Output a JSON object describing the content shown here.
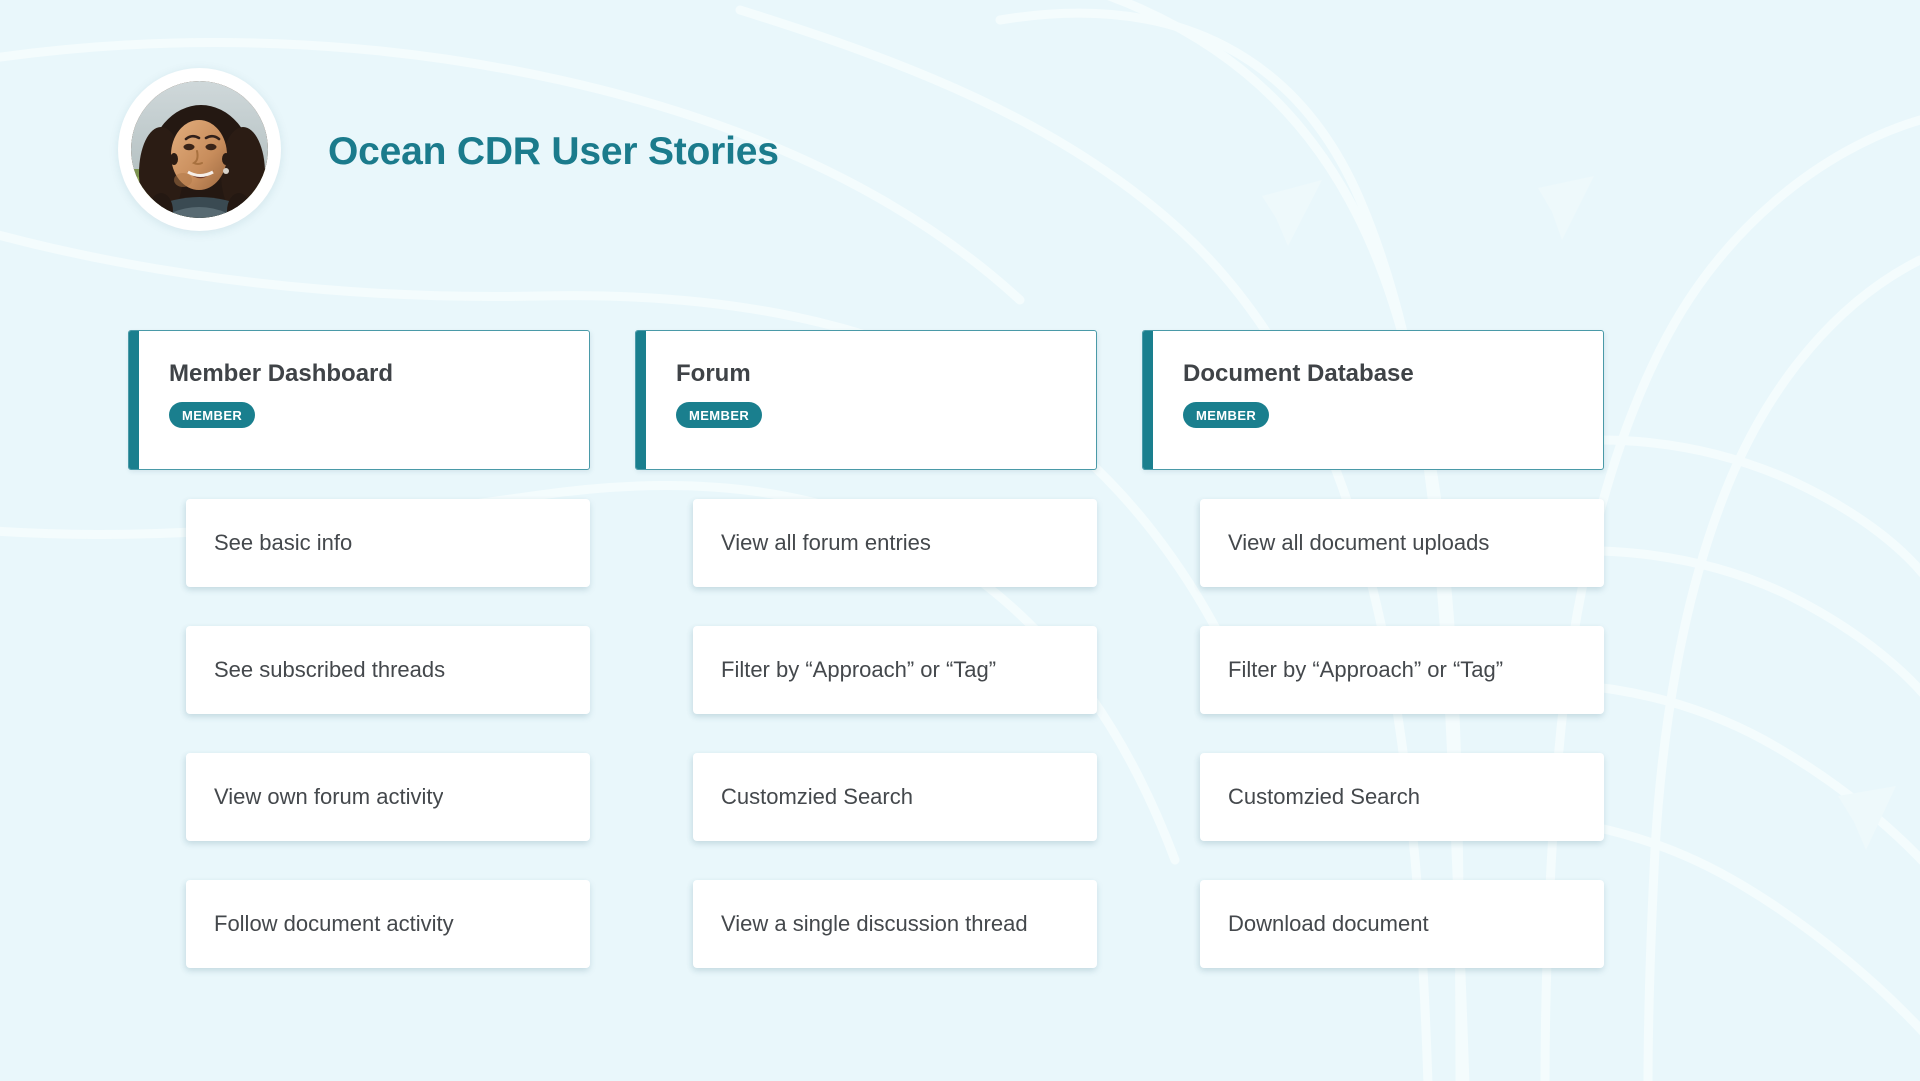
{
  "header": {
    "title": "Ocean CDR User Stories",
    "avatar_alt": "user-avatar-portrait"
  },
  "theme": {
    "background": "#e9f7fb",
    "accent_teal": "#1a7f8e",
    "title_color": "#1b7b8c",
    "card_background": "#ffffff",
    "text_color": "#44484c",
    "badge_text_color": "#ffffff"
  },
  "columns": [
    {
      "title": "Member Dashboard",
      "badge": "MEMBER",
      "items": [
        {
          "label": "See basic info"
        },
        {
          "label": "See subscribed threads"
        },
        {
          "label": "View own forum activity"
        },
        {
          "label": "Follow document activity"
        }
      ]
    },
    {
      "title": "Forum",
      "badge": "MEMBER",
      "items": [
        {
          "label": "View all forum entries"
        },
        {
          "label": "Filter by “Approach” or “Tag”"
        },
        {
          "label": "Customzied Search"
        },
        {
          "label": "View a single discussion thread"
        }
      ]
    },
    {
      "title": "Document Database",
      "badge": "MEMBER",
      "items": [
        {
          "label": "View all document uploads"
        },
        {
          "label": "Filter by “Approach” or “Tag”"
        },
        {
          "label": "Customzied Search"
        },
        {
          "label": "Download document"
        }
      ]
    }
  ]
}
